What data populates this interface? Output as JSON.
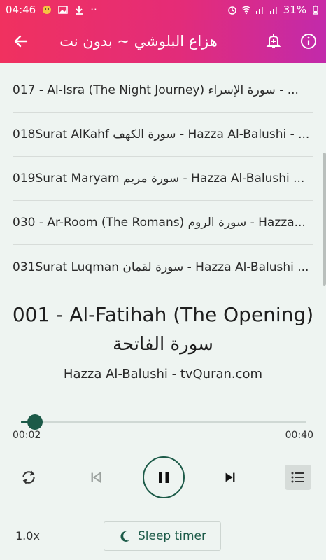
{
  "status_bar": {
    "time": "04:46",
    "battery": "31%"
  },
  "app_bar": {
    "title": "هزاع البلوشي ~ بدون نت"
  },
  "playlist": [
    "017 - Al-Isra (The Night Journey) سورة الإسراء - ...",
    "018Surat AlKahf سورة الكهف - Hazza Al-Balushi - ...",
    "019Surat Maryam سورة مريم - Hazza Al-Balushi ...",
    "030 - Ar-Room (The Romans) سورة الروم - Hazza...",
    "031Surat Luqman سورة لقمان - Hazza Al-Balushi ..."
  ],
  "now_playing": {
    "title": "001 - Al-Fatihah (The Opening)",
    "title_ar": "سورة الفاتحة",
    "artist": "Hazza Al-Balushi - tvQuran.com",
    "current_time": "00:02",
    "total_time": "00:40",
    "progress": 0.05
  },
  "controls": {
    "speed": "1.0x",
    "sleep_timer": "Sleep timer"
  },
  "colors": {
    "accent": "#1c5a48",
    "bar_start": "#f0315f",
    "bar_end": "#c22aab"
  }
}
